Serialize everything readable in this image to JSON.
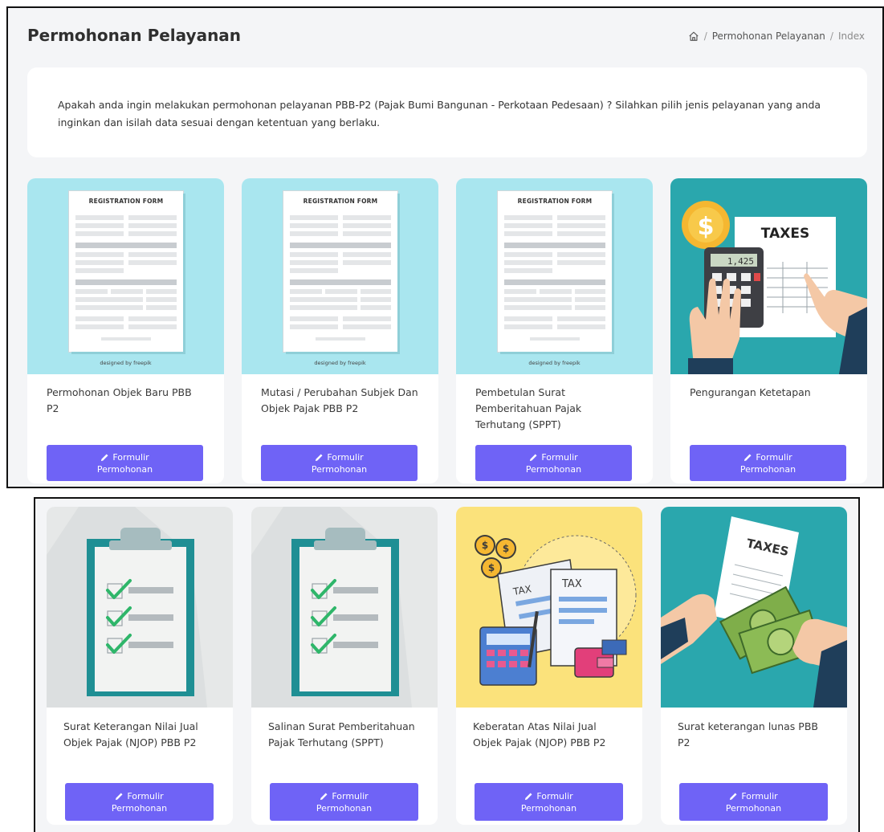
{
  "header": {
    "title": "Permohonan Pelayanan",
    "breadcrumb": [
      "Permohonan Pelayanan",
      "Index"
    ],
    "home_icon": "home-icon"
  },
  "intro": {
    "text": "Apakah anda ingin melakukan permohonan pelayanan PBB-P2 (Pajak Bumi Bangunan - Perkotaan Pedesaan) ? Silahkan pilih jenis pelayanan yang anda inginkan dan isilah data sesuai dengan ketentuan yang berlaku."
  },
  "illustration_text": {
    "registration_form": "REGISTRATION FORM",
    "designed_by": "designed by freepik",
    "taxes": "TAXES",
    "tax": "TAX",
    "calculator_display": "1,425"
  },
  "button": {
    "line1": "Formulir",
    "line2": "Permohonan",
    "icon": "pencil-icon",
    "color": "#6f63f6"
  },
  "services": [
    {
      "title": "Permohonan Objek Baru PBB P2",
      "image": "registration-form-illustration",
      "bg": "#a9e6ef"
    },
    {
      "title": "Mutasi / Perubahan Subjek Dan Objek Pajak PBB P2",
      "image": "registration-form-illustration",
      "bg": "#a9e6ef"
    },
    {
      "title": "Pembetulan Surat Pemberitahuan Pajak Terhutang (SPPT)",
      "image": "registration-form-illustration",
      "bg": "#a9e6ef"
    },
    {
      "title": "Pengurangan Ketetapan",
      "image": "taxes-calculator-illustration",
      "bg": "#2aa7ad"
    },
    {
      "title": "Surat Keterangan Nilai Jual Objek Pajak (NJOP) PBB P2",
      "image": "checklist-clipboard-illustration",
      "bg": "#e6e8e8"
    },
    {
      "title": "Salinan Surat Pemberitahuan Pajak Terhutang (SPPT)",
      "image": "checklist-clipboard-illustration",
      "bg": "#e6e8e8"
    },
    {
      "title": "Keberatan Atas Nilai Jual Objek Pajak (NJOP) PBB P2",
      "image": "tax-documents-illustration",
      "bg": "#fbe27b"
    },
    {
      "title": "Surat keterangan lunas PBB P2",
      "image": "taxes-money-illustration",
      "bg": "#2aa7ad"
    }
  ]
}
